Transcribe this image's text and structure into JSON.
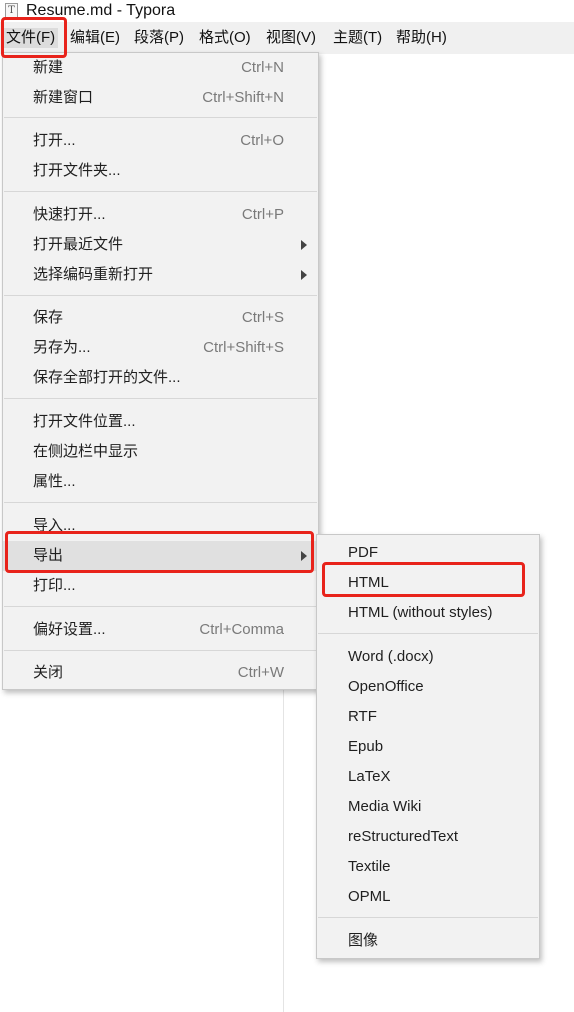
{
  "window": {
    "title": "Resume.md - Typora",
    "icon": "T"
  },
  "menubar": {
    "items": [
      "文件(F)",
      "编辑(E)",
      "段落(P)",
      "格式(O)",
      "视图(V)",
      "主题(T)",
      "帮助(H)"
    ]
  },
  "file_menu": {
    "new": {
      "label": "新建",
      "shortcut": "Ctrl+N"
    },
    "new_window": {
      "label": "新建窗口",
      "shortcut": "Ctrl+Shift+N"
    },
    "open": {
      "label": "打开...",
      "shortcut": "Ctrl+O"
    },
    "open_folder": {
      "label": "打开文件夹..."
    },
    "quick_open": {
      "label": "快速打开...",
      "shortcut": "Ctrl+P"
    },
    "open_recent": {
      "label": "打开最近文件"
    },
    "reopen_encoding": {
      "label": "选择编码重新打开"
    },
    "save": {
      "label": "保存",
      "shortcut": "Ctrl+S"
    },
    "save_as": {
      "label": "另存为...",
      "shortcut": "Ctrl+Shift+S"
    },
    "save_all": {
      "label": "保存全部打开的文件..."
    },
    "open_location": {
      "label": "打开文件位置..."
    },
    "reveal_sidebar": {
      "label": "在侧边栏中显示"
    },
    "properties": {
      "label": "属性..."
    },
    "import": {
      "label": "导入..."
    },
    "export": {
      "label": "导出"
    },
    "print": {
      "label": "打印..."
    },
    "preferences": {
      "label": "偏好设置...",
      "shortcut": "Ctrl+Comma"
    },
    "close": {
      "label": "关闭",
      "shortcut": "Ctrl+W"
    }
  },
  "export_menu": {
    "items": [
      "PDF",
      "HTML",
      "HTML (without styles)",
      "Word (.docx)",
      "OpenOffice",
      "RTF",
      "Epub",
      "LaTeX",
      "Media Wiki",
      "reStructuredText",
      "Textile",
      "OPML",
      "图像"
    ]
  },
  "colors": {
    "annotation": "#e8231b",
    "menu_bg": "#f2f2f2",
    "hover_bg": "#e0e0e0",
    "shortcut_text": "#7a7a7a"
  }
}
